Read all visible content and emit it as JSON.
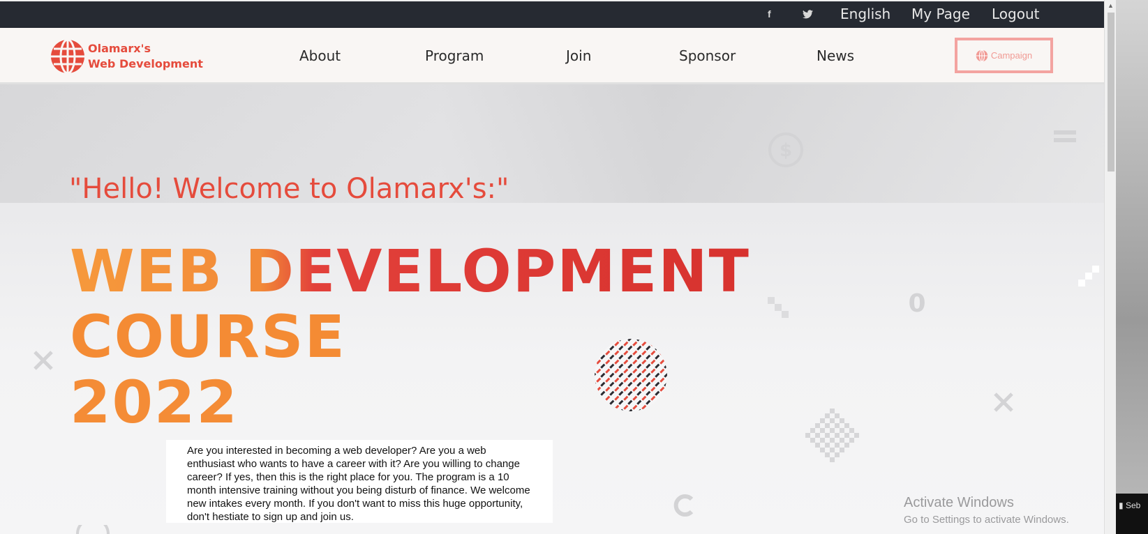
{
  "topbar": {
    "facebook_icon": "f",
    "twitter_icon": "twitter-bird",
    "language": "English",
    "my_page": "My Page",
    "logout": "Logout"
  },
  "logo": {
    "line1": "Olamarx's",
    "line2": "Web Development"
  },
  "nav": {
    "items": [
      "About",
      "Program",
      "Join",
      "Sponsor",
      "News"
    ],
    "campaign": "Campaign"
  },
  "hero": {
    "greeting": "\"Hello! Welcome to Olamarx's:\"",
    "title_line1": "WEB DEVELOPMENT",
    "title_line2": "COURSE",
    "title_line3": "2022",
    "description": "Are you interested in becoming a web developer? Are you a web enthusiast who wants to have a career with it? Are you willing to change career? If yes, then this is the right place for you. The program is a 10 month intensive training without you being disturb of finance. We welcome new intakes every month. If you don't want to miss this huge opportunity, don't hestiate to sign up and join us."
  },
  "watermark": {
    "title": "Activate Windows",
    "subtitle": "Go to Settings to activate Windows."
  },
  "taskbar": {
    "text": "Seb"
  },
  "colors": {
    "accent": "#e54b3c",
    "topbar_bg": "#262a32",
    "navbar_bg": "#f9f6f4",
    "campaign_border": "#f3a3a0"
  }
}
